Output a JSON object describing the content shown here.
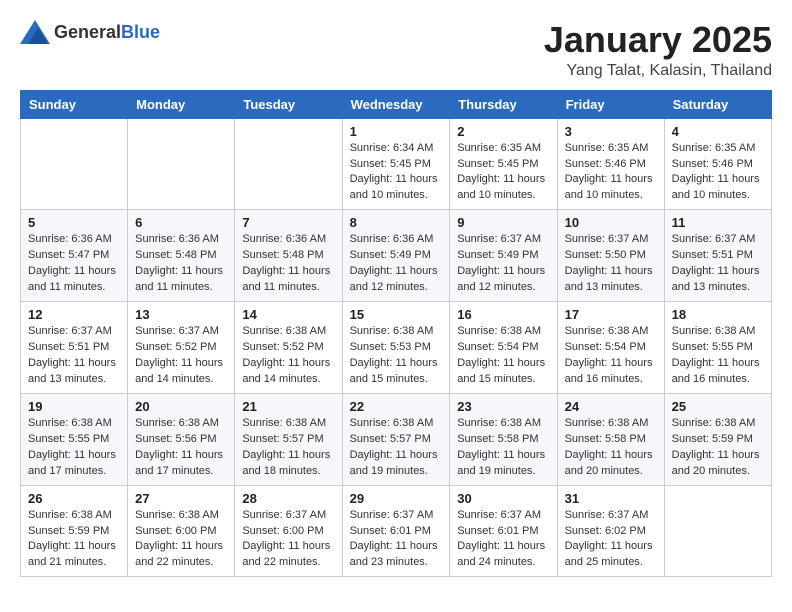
{
  "header": {
    "logo_general": "General",
    "logo_blue": "Blue",
    "month_title": "January 2025",
    "location": "Yang Talat, Kalasin, Thailand"
  },
  "days_of_week": [
    "Sunday",
    "Monday",
    "Tuesday",
    "Wednesday",
    "Thursday",
    "Friday",
    "Saturday"
  ],
  "weeks": [
    [
      {
        "day": "",
        "info": ""
      },
      {
        "day": "",
        "info": ""
      },
      {
        "day": "",
        "info": ""
      },
      {
        "day": "1",
        "info": "Sunrise: 6:34 AM\nSunset: 5:45 PM\nDaylight: 11 hours\nand 10 minutes."
      },
      {
        "day": "2",
        "info": "Sunrise: 6:35 AM\nSunset: 5:45 PM\nDaylight: 11 hours\nand 10 minutes."
      },
      {
        "day": "3",
        "info": "Sunrise: 6:35 AM\nSunset: 5:46 PM\nDaylight: 11 hours\nand 10 minutes."
      },
      {
        "day": "4",
        "info": "Sunrise: 6:35 AM\nSunset: 5:46 PM\nDaylight: 11 hours\nand 10 minutes."
      }
    ],
    [
      {
        "day": "5",
        "info": "Sunrise: 6:36 AM\nSunset: 5:47 PM\nDaylight: 11 hours\nand 11 minutes."
      },
      {
        "day": "6",
        "info": "Sunrise: 6:36 AM\nSunset: 5:48 PM\nDaylight: 11 hours\nand 11 minutes."
      },
      {
        "day": "7",
        "info": "Sunrise: 6:36 AM\nSunset: 5:48 PM\nDaylight: 11 hours\nand 11 minutes."
      },
      {
        "day": "8",
        "info": "Sunrise: 6:36 AM\nSunset: 5:49 PM\nDaylight: 11 hours\nand 12 minutes."
      },
      {
        "day": "9",
        "info": "Sunrise: 6:37 AM\nSunset: 5:49 PM\nDaylight: 11 hours\nand 12 minutes."
      },
      {
        "day": "10",
        "info": "Sunrise: 6:37 AM\nSunset: 5:50 PM\nDaylight: 11 hours\nand 13 minutes."
      },
      {
        "day": "11",
        "info": "Sunrise: 6:37 AM\nSunset: 5:51 PM\nDaylight: 11 hours\nand 13 minutes."
      }
    ],
    [
      {
        "day": "12",
        "info": "Sunrise: 6:37 AM\nSunset: 5:51 PM\nDaylight: 11 hours\nand 13 minutes."
      },
      {
        "day": "13",
        "info": "Sunrise: 6:37 AM\nSunset: 5:52 PM\nDaylight: 11 hours\nand 14 minutes."
      },
      {
        "day": "14",
        "info": "Sunrise: 6:38 AM\nSunset: 5:52 PM\nDaylight: 11 hours\nand 14 minutes."
      },
      {
        "day": "15",
        "info": "Sunrise: 6:38 AM\nSunset: 5:53 PM\nDaylight: 11 hours\nand 15 minutes."
      },
      {
        "day": "16",
        "info": "Sunrise: 6:38 AM\nSunset: 5:54 PM\nDaylight: 11 hours\nand 15 minutes."
      },
      {
        "day": "17",
        "info": "Sunrise: 6:38 AM\nSunset: 5:54 PM\nDaylight: 11 hours\nand 16 minutes."
      },
      {
        "day": "18",
        "info": "Sunrise: 6:38 AM\nSunset: 5:55 PM\nDaylight: 11 hours\nand 16 minutes."
      }
    ],
    [
      {
        "day": "19",
        "info": "Sunrise: 6:38 AM\nSunset: 5:55 PM\nDaylight: 11 hours\nand 17 minutes."
      },
      {
        "day": "20",
        "info": "Sunrise: 6:38 AM\nSunset: 5:56 PM\nDaylight: 11 hours\nand 17 minutes."
      },
      {
        "day": "21",
        "info": "Sunrise: 6:38 AM\nSunset: 5:57 PM\nDaylight: 11 hours\nand 18 minutes."
      },
      {
        "day": "22",
        "info": "Sunrise: 6:38 AM\nSunset: 5:57 PM\nDaylight: 11 hours\nand 19 minutes."
      },
      {
        "day": "23",
        "info": "Sunrise: 6:38 AM\nSunset: 5:58 PM\nDaylight: 11 hours\nand 19 minutes."
      },
      {
        "day": "24",
        "info": "Sunrise: 6:38 AM\nSunset: 5:58 PM\nDaylight: 11 hours\nand 20 minutes."
      },
      {
        "day": "25",
        "info": "Sunrise: 6:38 AM\nSunset: 5:59 PM\nDaylight: 11 hours\nand 20 minutes."
      }
    ],
    [
      {
        "day": "26",
        "info": "Sunrise: 6:38 AM\nSunset: 5:59 PM\nDaylight: 11 hours\nand 21 minutes."
      },
      {
        "day": "27",
        "info": "Sunrise: 6:38 AM\nSunset: 6:00 PM\nDaylight: 11 hours\nand 22 minutes."
      },
      {
        "day": "28",
        "info": "Sunrise: 6:37 AM\nSunset: 6:00 PM\nDaylight: 11 hours\nand 22 minutes."
      },
      {
        "day": "29",
        "info": "Sunrise: 6:37 AM\nSunset: 6:01 PM\nDaylight: 11 hours\nand 23 minutes."
      },
      {
        "day": "30",
        "info": "Sunrise: 6:37 AM\nSunset: 6:01 PM\nDaylight: 11 hours\nand 24 minutes."
      },
      {
        "day": "31",
        "info": "Sunrise: 6:37 AM\nSunset: 6:02 PM\nDaylight: 11 hours\nand 25 minutes."
      },
      {
        "day": "",
        "info": ""
      }
    ]
  ]
}
